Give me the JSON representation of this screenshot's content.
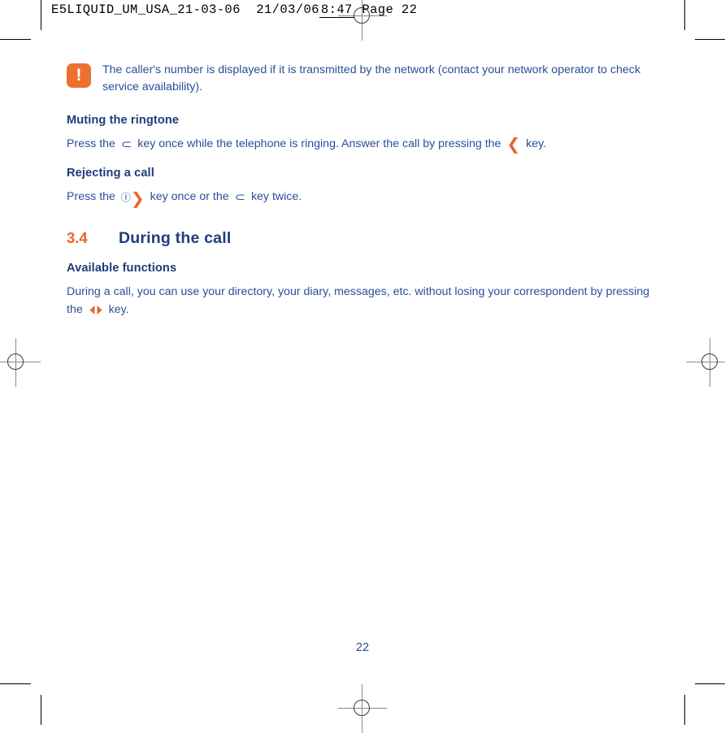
{
  "print_slug": {
    "filename": "E5LIQUID_UM_USA_21-03-06",
    "date": "21/03/06",
    "time": "8:47",
    "page_label": "Page 22"
  },
  "note": {
    "icon": "exclamation-icon",
    "text": "The caller's number is displayed if it is transmitted by the network (contact your network operator to check service availability).",
    "icon_glyph": "!",
    "icon_color": "#ED7030",
    "text_color": "#2B4E9B"
  },
  "sections": {
    "muting": {
      "heading": "Muting the ringtone",
      "body_part1": "Press the",
      "key1": "cancel-key-icon",
      "key1_glyph": "⊂",
      "body_part2": "key once while the telephone is ringing. Answer the call by pressing the",
      "key2": "pickup-key-icon",
      "key2_glyph": "❮",
      "body_part3": "key."
    },
    "rejecting": {
      "heading": "Rejecting a call",
      "body_part1": "Press the",
      "key1": "hangup-power-key-icon",
      "key1_glyph_power": "Ⓘ",
      "key1_glyph_bracket": "❯",
      "body_part2": "key once or the",
      "key2": "cancel-key-icon",
      "key2_glyph": "⊂",
      "body_part3": "key twice."
    },
    "during_call": {
      "number": "3.4",
      "title": "During the call",
      "sub_heading": "Available functions",
      "body_part1": "During a call, you can use your directory, your diary, messages, etc. without losing your correspondent by pressing the",
      "key1": "navigation-key-icon",
      "body_part2": "key."
    }
  },
  "footer": {
    "page_number": "22"
  },
  "colors": {
    "heading_blue": "#1F3C7A",
    "body_blue": "#2B4E9B",
    "accent_orange": "#E8642B",
    "icon_orange": "#ED7030"
  }
}
